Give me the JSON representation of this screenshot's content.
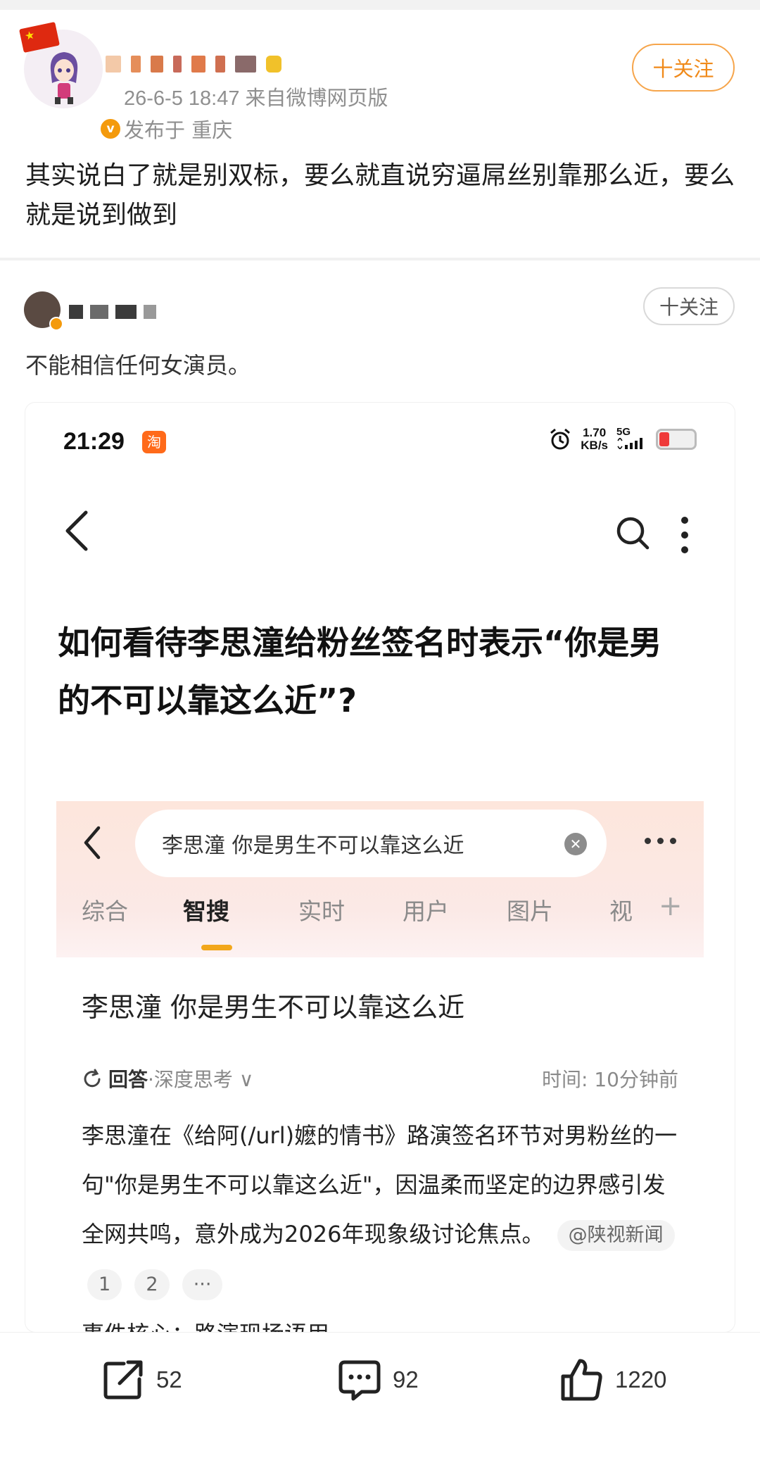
{
  "post": {
    "meta": "26-6-5 18:47  来自微博网页版",
    "location": "发布于 重庆",
    "follow_label": "十关注",
    "text": "其实说白了就是别双标，要么就直说穷逼屌丝别靠那么近，要么就是说到做到"
  },
  "repost": {
    "follow_label": "十关注",
    "text": "不能相信任何女演员。"
  },
  "screenshot": {
    "status_time": "21:29",
    "taobao_badge": "淘",
    "net_speed_value": "1.70",
    "net_speed_unit": "KB/s",
    "network": "5G",
    "question_title": "如何看待李思潼给粉丝签名时表示“你是男的不可以靠这么近”?",
    "inner": {
      "search_query": "李思潼 你是男生不可以靠这么近",
      "tabs": [
        "综合",
        "智搜",
        "实时",
        "用户",
        "图片",
        "视"
      ],
      "active_tab_index": 1,
      "result_title": "李思潼 你是男生不可以靠这么近",
      "answer_label": "回答",
      "answer_sub": "·深度思考 ∨",
      "time_label": "时间:  10分钟前",
      "body": "李思潼在《给阿(/url)嬷的情书》路演签名环节对男粉丝的一句\"你是男生不可以靠这么近\"，因温柔而坚定的边界感引发全网共鸣，意外成为2026年现象级讨论焦点。",
      "source_chip": "@陕视新闻",
      "ref_chips": [
        "1",
        "2",
        "···"
      ],
      "cut_off_line": "事件核心：路演现场语用"
    }
  },
  "actions": {
    "repost_count": "52",
    "comment_count": "92",
    "like_count": "1220"
  },
  "colors": {
    "follow_orange": "#f08a1a",
    "verified_badge": "#f49a0c",
    "tab_underline": "#f2a71b"
  }
}
